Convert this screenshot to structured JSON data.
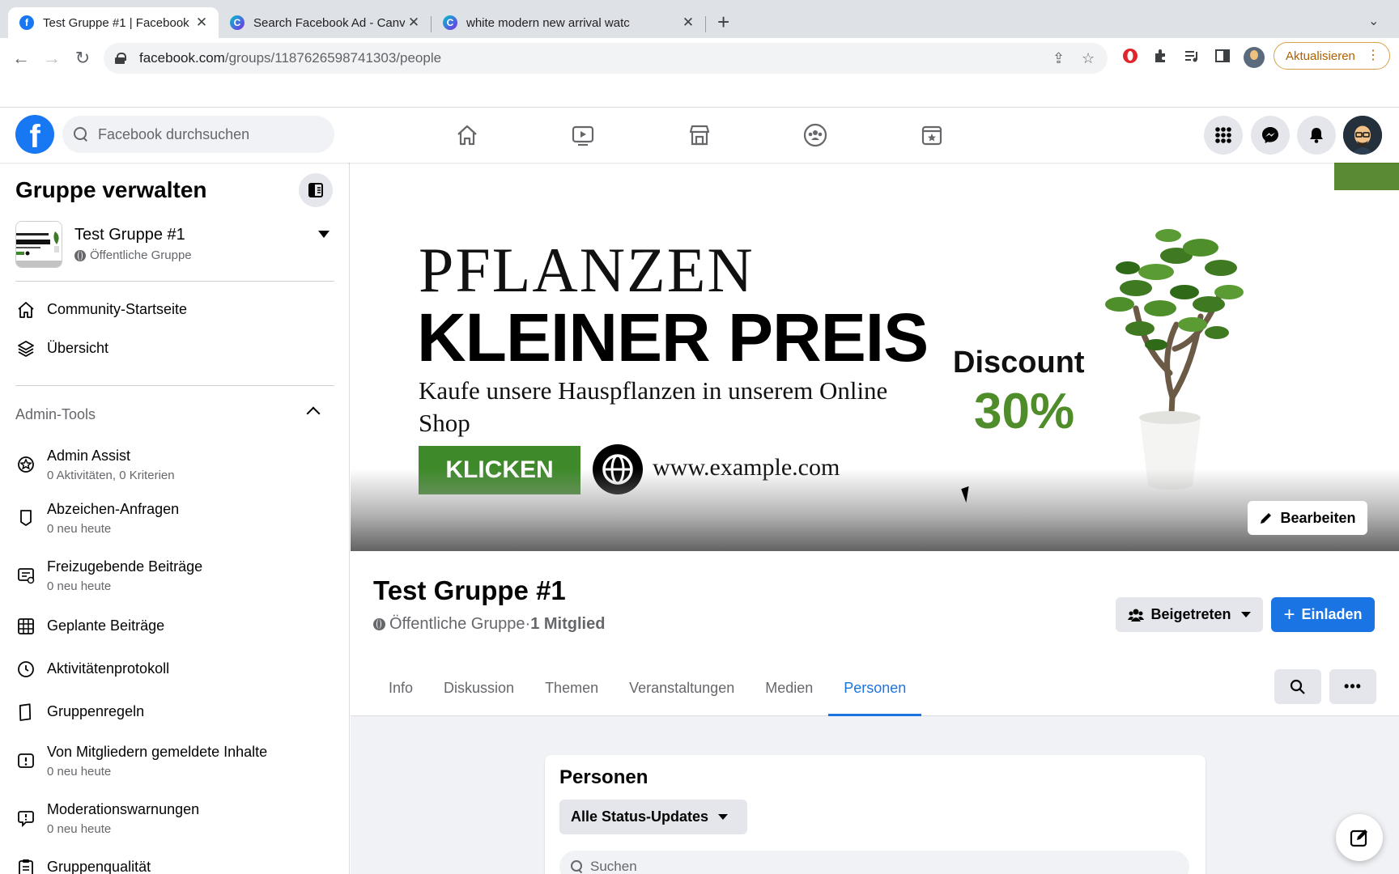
{
  "browser": {
    "tabs": [
      {
        "title": "Test Gruppe #1 | Facebook",
        "favicon": "facebook-icon",
        "active": true
      },
      {
        "title": "Search Facebook Ad - Canva",
        "favicon": "canva-icon",
        "active": false
      },
      {
        "title": "white modern new arrival watc",
        "favicon": "canva-icon",
        "active": false
      }
    ],
    "url_host": "facebook.com",
    "url_path": "/groups/1187626598741303/people",
    "update_label": "Aktualisieren"
  },
  "fb": {
    "search_placeholder": "Facebook durchsuchen",
    "accent": "#1877f2"
  },
  "sidebar": {
    "title": "Gruppe verwalten",
    "group_name": "Test Gruppe #1",
    "group_type": "Öffentliche Gruppe",
    "nav": [
      {
        "label": "Community-Startseite",
        "icon": "home-icon"
      },
      {
        "label": "Übersicht",
        "icon": "layers-icon"
      }
    ],
    "section_label": "Admin-Tools",
    "admin_items": [
      {
        "label": "Admin Assist",
        "sub": "0 Aktivitäten, 0 Kriterien",
        "icon": "admin-assist-icon"
      },
      {
        "label": "Abzeichen-Anfragen",
        "sub": "0 neu heute",
        "icon": "badge-icon"
      },
      {
        "label": "Freizugebende Beiträge",
        "sub": "0 neu heute",
        "icon": "pending-posts-icon"
      },
      {
        "label": "Geplante Beiträge",
        "sub": "",
        "icon": "calendar-grid-icon"
      },
      {
        "label": "Aktivitätenprotokoll",
        "sub": "",
        "icon": "clock-icon"
      },
      {
        "label": "Gruppenregeln",
        "sub": "",
        "icon": "rules-icon"
      },
      {
        "label": "Von Mitgliedern gemeldete Inhalte",
        "sub": "0 neu heute",
        "icon": "report-icon"
      },
      {
        "label": "Moderationswarnungen",
        "sub": "0 neu heute",
        "icon": "warning-bubble-icon"
      },
      {
        "label": "Gruppenqualität",
        "sub": "",
        "icon": "clipboard-icon"
      }
    ]
  },
  "cover": {
    "headline1": "PFLANZEN",
    "headline2": "KLEINER PREIS",
    "tagline": "Kaufe unsere Hauspflanzen in unserem Online Shop",
    "cta": "KLICKEN",
    "website": "www.example.com",
    "discount_label": "Discount",
    "discount_value": "30%",
    "edit_label": "Bearbeiten",
    "green": "#3e8a2a"
  },
  "group": {
    "name": "Test Gruppe #1",
    "type": "Öffentliche Gruppe",
    "separator": " · ",
    "members": "1 Mitglied",
    "joined_label": "Beigetreten",
    "invite_label": "Einladen",
    "tabs": [
      "Info",
      "Diskussion",
      "Themen",
      "Veranstaltungen",
      "Medien",
      "Personen"
    ],
    "active_tab": "Personen"
  },
  "people": {
    "title": "Personen",
    "filter_label": "Alle Status-Updates",
    "search_placeholder": "Suchen"
  }
}
